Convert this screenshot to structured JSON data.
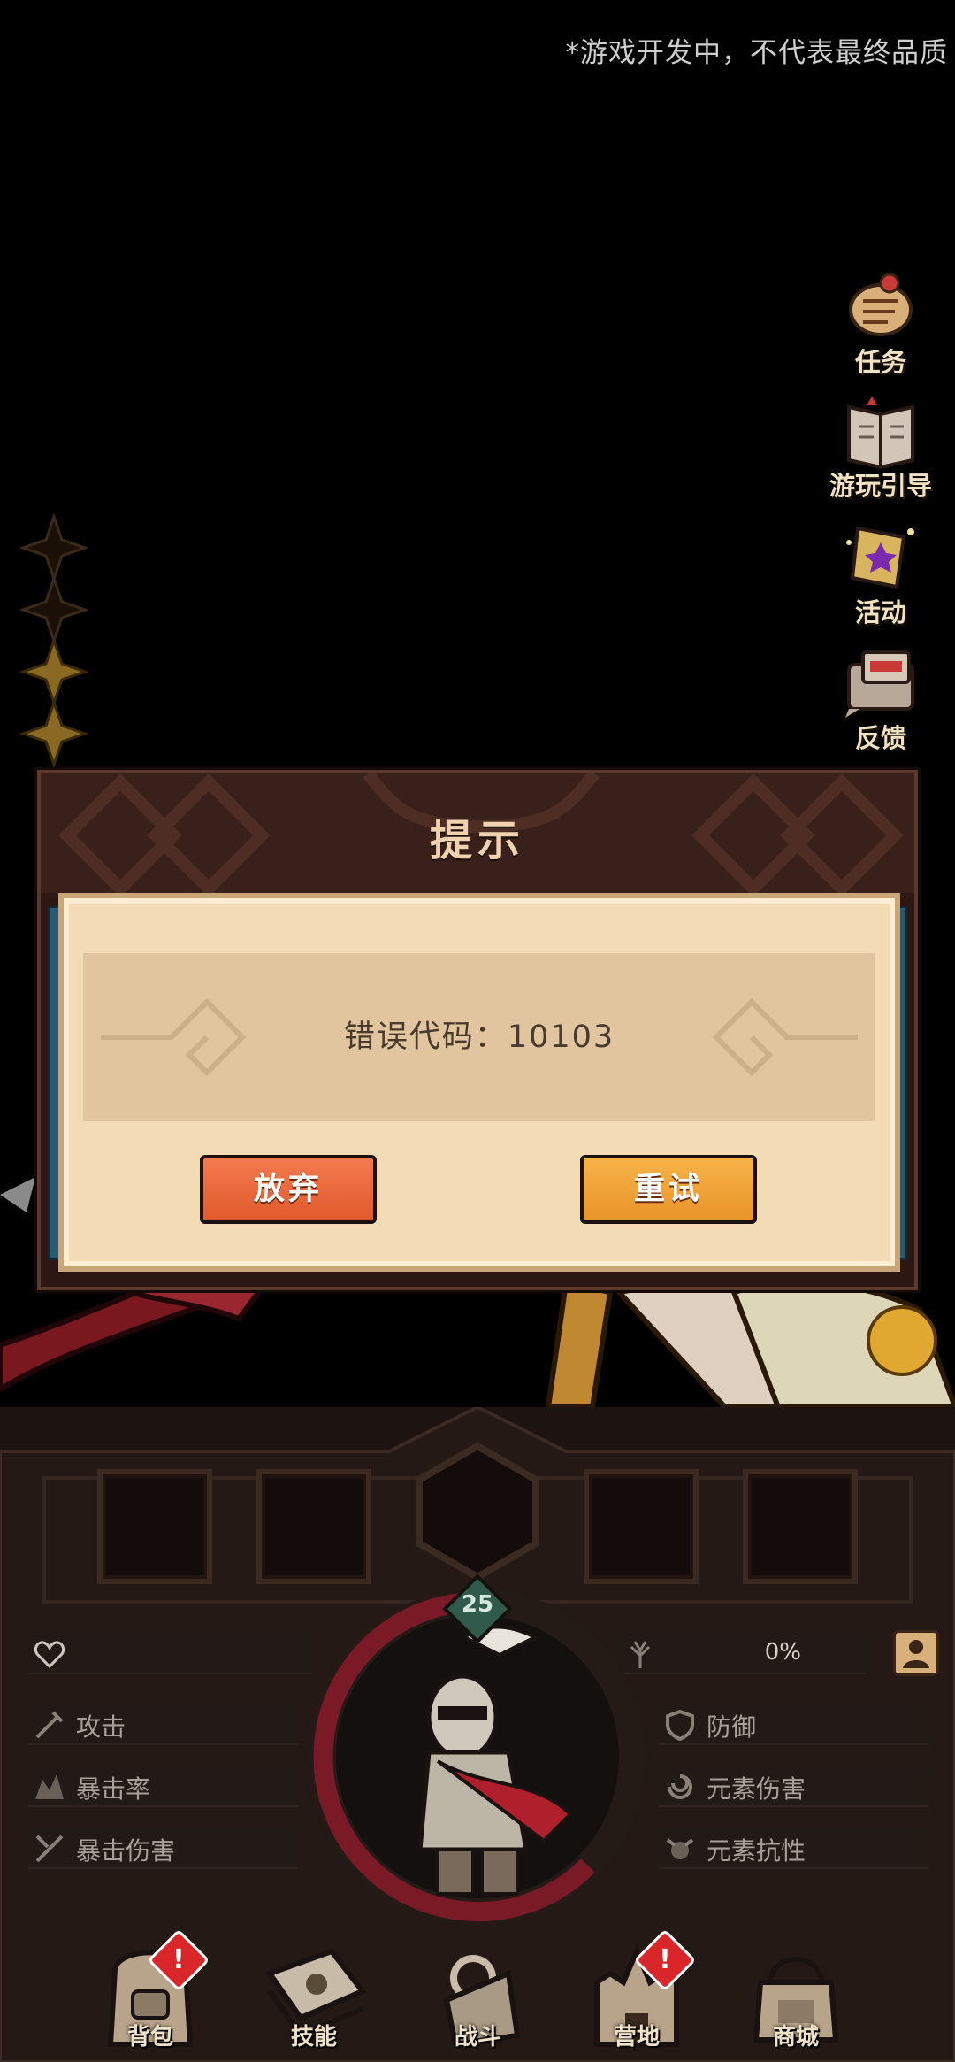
{
  "notice": "*游戏开发中，不代表最终品质",
  "side_menu": [
    {
      "label": "任务",
      "icon": "quest-scroll-icon"
    },
    {
      "label": "游玩引导",
      "icon": "guide-book-icon"
    },
    {
      "label": "活动",
      "icon": "event-scroll-icon"
    },
    {
      "label": "反馈",
      "icon": "feedback-mail-icon"
    }
  ],
  "stars": {
    "total": 4,
    "lit": 2
  },
  "dialog": {
    "title": "提示",
    "message": "错误代码：10103",
    "abandon_label": "放弃",
    "retry_label": "重试"
  },
  "character": {
    "level": "25"
  },
  "stats": {
    "hp_percent": "0%",
    "attack": "攻击",
    "crit_rate": "暴击率",
    "crit_damage": "暴击伤害",
    "defense": "防御",
    "elemental_damage": "元素伤害",
    "elemental_resistance": "元素抗性"
  },
  "bottom_nav": [
    {
      "label": "背包",
      "badge": "!"
    },
    {
      "label": "技能",
      "badge": ""
    },
    {
      "label": "战斗",
      "badge": ""
    },
    {
      "label": "营地",
      "badge": "!"
    },
    {
      "label": "商城",
      "badge": ""
    }
  ],
  "colors": {
    "abandon_button": "#e9643a",
    "retry_button": "#f0a63a",
    "dialog_paper": "#f3dcb5",
    "hp_ring": "#7a1a26",
    "level_badge": "#2f5a4c"
  }
}
